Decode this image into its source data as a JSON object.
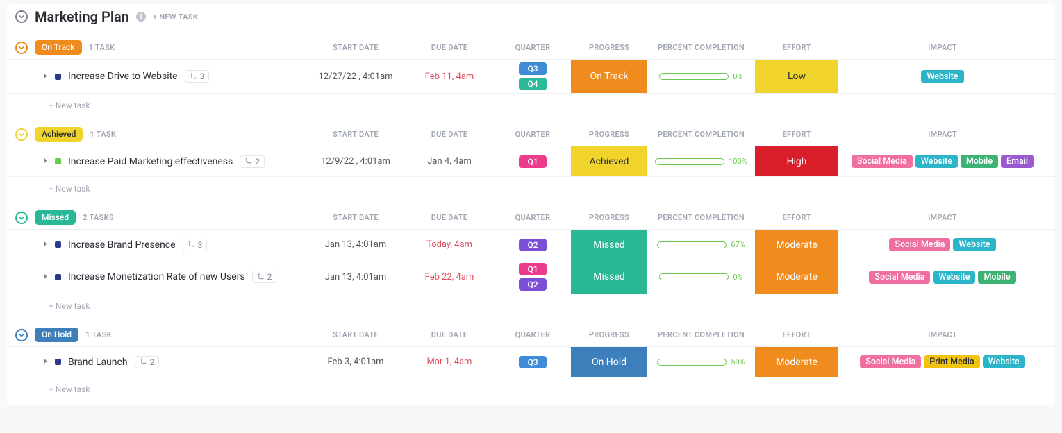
{
  "board": {
    "title": "Marketing Plan",
    "info_symbol": "i",
    "new_task_top": "+ NEW TASK"
  },
  "columns": {
    "start_date": "START DATE",
    "due_date": "DUE DATE",
    "quarter": "QUARTER",
    "progress": "PROGRESS",
    "percent": "PERCENT COMPLETION",
    "effort": "EFFORT",
    "impact": "IMPACT"
  },
  "new_task_label": "+ New task",
  "quarter_colors": {
    "Q1": "#eb3b8b",
    "Q2": "#7a4fd6",
    "Q3": "#3e8bd6",
    "Q4": "#2cb99a"
  },
  "impact_colors": {
    "Social Media": "#ef6fa1",
    "Website": "#2cb5c9",
    "Mobile": "#3cb373",
    "Email": "#9b59d0",
    "Print Media": "#f1c40f"
  },
  "progress_colors": {
    "On Track": "#f08c1e",
    "Achieved": "#f1d42b",
    "Missed": "#2ab795",
    "On Hold": "#3d7fba"
  },
  "effort_colors": {
    "Low": "#f1d42b",
    "High": "#d91f2a",
    "Moderate": "#f08c1e"
  },
  "groups": [
    {
      "name": "On Track",
      "pill_color": "#f08c1e",
      "ring_color": "#f08c1e",
      "task_count": "1 TASK",
      "rows": [
        {
          "square_color": "#2b3a8c",
          "name": "Increase Drive to Website",
          "subtasks": "3",
          "start": "12/27/22 , 4:01am",
          "due": "Feb 11, 4am",
          "due_red": true,
          "quarters": [
            "Q3",
            "Q4"
          ],
          "progress": "On Track",
          "percent": 0,
          "percent_label": "0%",
          "effort": "Low",
          "impact": [
            "Website"
          ]
        }
      ]
    },
    {
      "name": "Achieved",
      "pill_color": "#f1d42b",
      "pill_text_color": "#2a2e34",
      "ring_color": "#f1d42b",
      "task_count": "1 TASK",
      "rows": [
        {
          "square_color": "#6bc950",
          "name": "Increase Paid Marketing effectiveness",
          "subtasks": "2",
          "start": "12/9/22 , 4:01am",
          "due": "Jan 4, 4am",
          "due_red": false,
          "quarters": [
            "Q1"
          ],
          "progress": "Achieved",
          "progress_text_color": "#2a2e34",
          "percent": 100,
          "percent_label": "100%",
          "effort": "High",
          "impact": [
            "Social Media",
            "Website",
            "Mobile",
            "Email"
          ]
        }
      ]
    },
    {
      "name": "Missed",
      "pill_color": "#2ab795",
      "ring_color": "#2ab795",
      "task_count": "2 TASKS",
      "rows": [
        {
          "square_color": "#2b3a8c",
          "name": "Increase Brand Presence",
          "subtasks": "3",
          "start": "Jan 13, 4:01am",
          "due": "Today, 4am",
          "due_red": true,
          "quarters": [
            "Q2"
          ],
          "progress": "Missed",
          "percent": 67,
          "percent_label": "67%",
          "effort": "Moderate",
          "impact": [
            "Social Media",
            "Website"
          ]
        },
        {
          "square_color": "#2b3a8c",
          "name": "Increase Monetization Rate of new Users",
          "subtasks": "2",
          "start": "Jan 13, 4:01am",
          "due": "Feb 22, 4am",
          "due_red": true,
          "quarters": [
            "Q1",
            "Q2"
          ],
          "progress": "Missed",
          "percent": 0,
          "percent_label": "0%",
          "effort": "Moderate",
          "impact": [
            "Social Media",
            "Website",
            "Mobile"
          ]
        }
      ]
    },
    {
      "name": "On Hold",
      "pill_color": "#3d7fba",
      "ring_color": "#3d7fba",
      "task_count": "1 TASK",
      "rows": [
        {
          "square_color": "#2b3a8c",
          "name": "Brand Launch",
          "subtasks": "2",
          "start": "Feb 3, 4:01am",
          "due": "Mar 1, 4am",
          "due_red": true,
          "quarters": [
            "Q3"
          ],
          "progress": "On Hold",
          "percent": 50,
          "percent_label": "50%",
          "effort": "Moderate",
          "impact": [
            "Social Media",
            "Print Media",
            "Website"
          ]
        }
      ]
    }
  ]
}
